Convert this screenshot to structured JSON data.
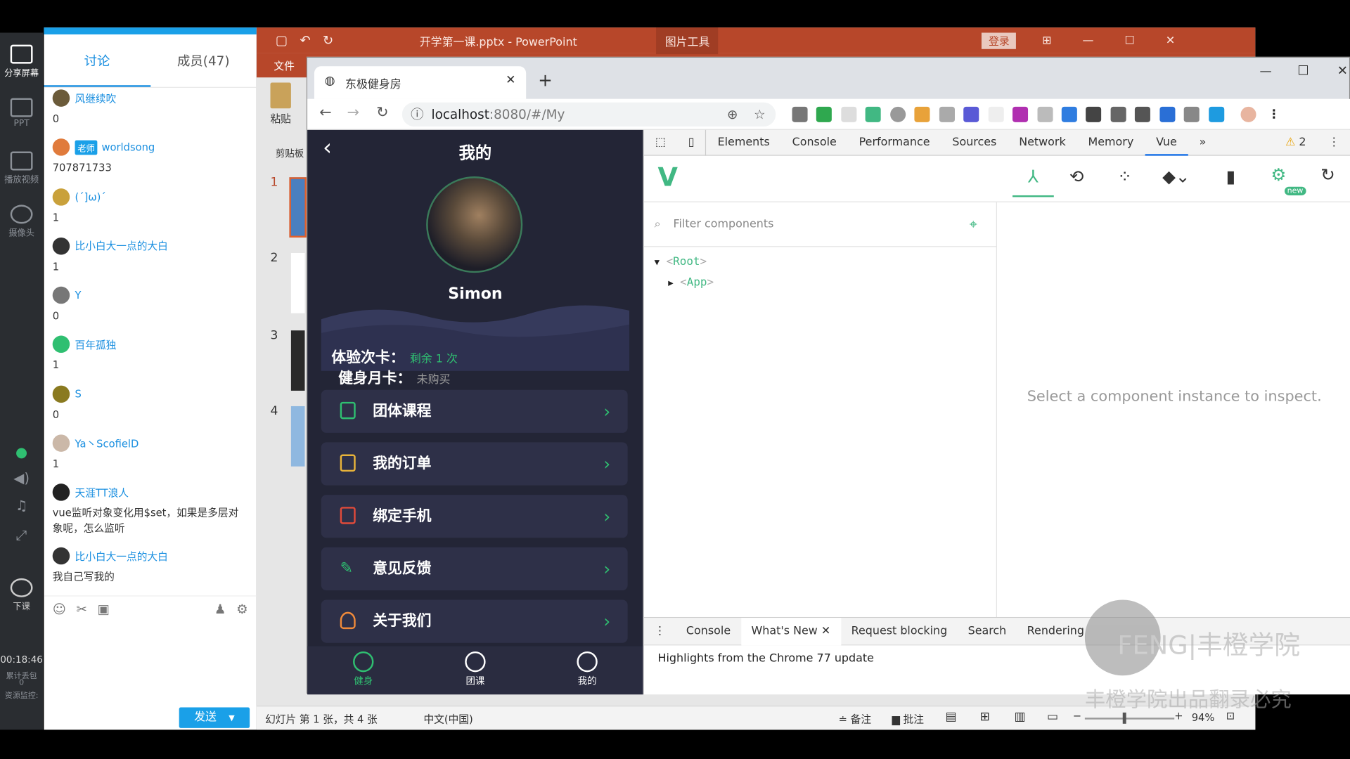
{
  "chat": {
    "tabs": [
      "讨论",
      "成员(47)"
    ],
    "messages": [
      {
        "name": "风继续吹",
        "text": "0",
        "badge": ""
      },
      {
        "name": "worldsong",
        "text": "707871733",
        "badge": "老师"
      },
      {
        "name": "(´]ω)´",
        "text": "1",
        "badge": ""
      },
      {
        "name": "比小白大一点的大白",
        "text": "1",
        "badge": ""
      },
      {
        "name": "Y",
        "text": "0",
        "badge": ""
      },
      {
        "name": "百年孤独",
        "text": "1",
        "badge": ""
      },
      {
        "name": "S",
        "text": "0",
        "badge": ""
      },
      {
        "name": "Ya丶ScofielD",
        "text": "1",
        "badge": ""
      },
      {
        "name": "天涯TT浪人",
        "text": "vue监听对象变化用$set，如果是多层对象呢，怎么监听",
        "badge": ""
      },
      {
        "name": "比小白大一点的大白",
        "text": "我自己写我的",
        "badge": ""
      }
    ],
    "send_label": "发送"
  },
  "rail": {
    "items": [
      "分享屏幕",
      "PPT",
      "播放视频",
      "摄像头"
    ],
    "end_label": "下课",
    "timer": "00:18:46",
    "stat1": "累计丢包",
    "stat1_value": "0",
    "stat2": "资源监控:"
  },
  "ppt": {
    "title": "开学第一课.pptx - PowerPoint",
    "picture_tools": "图片工具",
    "login": "登录",
    "file_menu": "文件",
    "paste": "粘贴",
    "clipboard": "剪贴板",
    "slide_numbers": [
      "1",
      "2",
      "3",
      "4"
    ],
    "status_slide": "幻灯片 第 1 张，共 4 张",
    "status_lang": "中文(中国)",
    "notes": "备注",
    "comments": "批注",
    "zoom": "94%"
  },
  "browser": {
    "tab_title": "东极健身房",
    "url_host": "localhost",
    "url_rest": ":8080/#/My"
  },
  "app": {
    "header_title": "我的",
    "username": "Simon",
    "card1_label": "体验次卡：",
    "card1_value": "剩余 1 次",
    "card2_label": "健身月卡：",
    "card2_value": "未购买",
    "menu": [
      "团体课程",
      "我的订单",
      "绑定手机",
      "意见反馈",
      "关于我们"
    ],
    "nav": [
      "健身",
      "团课",
      "我的"
    ],
    "colors": {
      "accent": "#2fbf71",
      "bg": "#232536"
    }
  },
  "devtools": {
    "tabs": [
      "Elements",
      "Console",
      "Performance",
      "Sources",
      "Network",
      "Memory",
      "Vue"
    ],
    "warnings": "2",
    "filter_placeholder": "Filter components",
    "tree_root": "Root",
    "tree_app": "App",
    "new_badge": "new",
    "inspect_hint": "Select a component instance to inspect.",
    "drawer_tabs": [
      "Console",
      "What's New",
      "Request blocking",
      "Search",
      "Rendering"
    ],
    "drawer_text": "Highlights from the Chrome 77 update"
  },
  "watermark": {
    "brand": "FENG|丰橙学院",
    "sub": "丰橙学院出品翻录必究"
  }
}
